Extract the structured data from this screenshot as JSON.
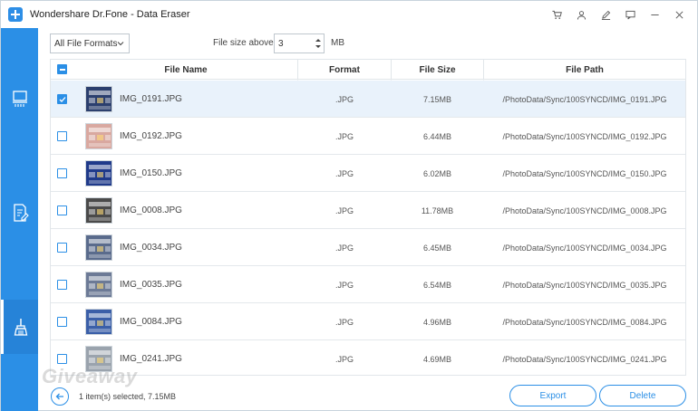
{
  "window": {
    "title": "Wondershare Dr.Fone - Data Eraser"
  },
  "title_icons": [
    "cart-icon",
    "user-icon",
    "edit-icon",
    "feedback-icon",
    "minimize-icon",
    "close-icon"
  ],
  "sidebar": {
    "items": [
      {
        "name": "erase-all-data",
        "icon": "device-erase-icon",
        "active": false
      },
      {
        "name": "erase-private-data",
        "icon": "document-erase-icon",
        "active": false
      },
      {
        "name": "free-up-space",
        "icon": "broom-icon",
        "active": true
      }
    ]
  },
  "filters": {
    "format_value": "All File Formats",
    "size_label": "File size above:",
    "size_value": "3",
    "size_unit": "MB"
  },
  "table": {
    "columns": {
      "name": "File Name",
      "format": "Format",
      "size": "File Size",
      "path": "File Path"
    },
    "rows": [
      {
        "name": "IMG_0191.JPG",
        "format": ".JPG",
        "size": "7.15MB",
        "path": "/PhotoData/Sync/100SYNCD/IMG_0191.JPG",
        "checked": true,
        "thumb": "#2b3f6e"
      },
      {
        "name": "IMG_0192.JPG",
        "format": ".JPG",
        "size": "6.44MB",
        "path": "/PhotoData/Sync/100SYNCD/IMG_0192.JPG",
        "checked": false,
        "thumb": "#d9a8a0"
      },
      {
        "name": "IMG_0150.JPG",
        "format": ".JPG",
        "size": "6.02MB",
        "path": "/PhotoData/Sync/100SYNCD/IMG_0150.JPG",
        "checked": false,
        "thumb": "#1f3a8a"
      },
      {
        "name": "IMG_0008.JPG",
        "format": ".JPG",
        "size": "11.78MB",
        "path": "/PhotoData/Sync/100SYNCD/IMG_0008.JPG",
        "checked": false,
        "thumb": "#4a4a4a"
      },
      {
        "name": "IMG_0034.JPG",
        "format": ".JPG",
        "size": "6.45MB",
        "path": "/PhotoData/Sync/100SYNCD/IMG_0034.JPG",
        "checked": false,
        "thumb": "#5a6b8c"
      },
      {
        "name": "IMG_0035.JPG",
        "format": ".JPG",
        "size": "6.54MB",
        "path": "/PhotoData/Sync/100SYNCD/IMG_0035.JPG",
        "checked": false,
        "thumb": "#6c7a96"
      },
      {
        "name": "IMG_0084.JPG",
        "format": ".JPG",
        "size": "4.96MB",
        "path": "/PhotoData/Sync/100SYNCD/IMG_0084.JPG",
        "checked": false,
        "thumb": "#3b5fa8"
      },
      {
        "name": "IMG_0241.JPG",
        "format": ".JPG",
        "size": "4.69MB",
        "path": "/PhotoData/Sync/100SYNCD/IMG_0241.JPG",
        "checked": false,
        "thumb": "#9aa3ad"
      }
    ]
  },
  "footer": {
    "status": "1 item(s) selected, 7.15MB",
    "watermark": "Giveaway",
    "export_label": "Export",
    "delete_label": "Delete"
  },
  "colors": {
    "accent": "#2b8fe6",
    "selected_row": "#e9f2fb"
  }
}
